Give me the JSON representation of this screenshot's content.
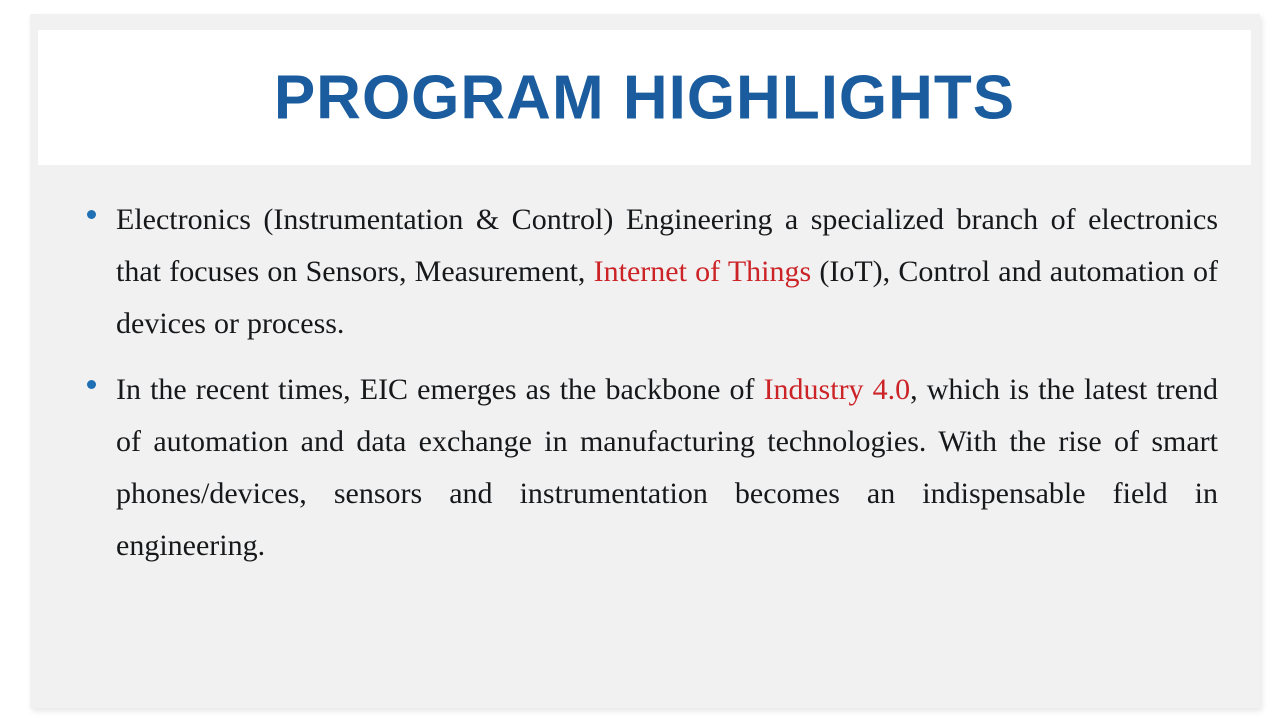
{
  "slide": {
    "title": "PROGRAM HIGHLIGHTS",
    "title_color": "#1a5c9e",
    "canvas_color": "#f1f1f2",
    "title_band_color": "#ffffff",
    "bullet_marker_color": "#1f6fb5",
    "body_text_color": "#16181a",
    "accent_color": "#cc2327"
  },
  "bullets": [
    {
      "marker": "bullet-dot",
      "segments": [
        {
          "text": "Electronics (Instrumentation & Control) Engineering a specialized branch of electronics that focuses on Sensors, Measurement, ",
          "emphasis": "none"
        },
        {
          "text": "Internet of Things",
          "emphasis": "accent"
        },
        {
          "text": " (IoT), Control and automation of devices or process.",
          "emphasis": "none"
        }
      ],
      "plain_text": "Electronics (Instrumentation & Control) Engineering a specialized branch of electronics that focuses on Sensors, Measurement, Internet of Things (IoT), Control and automation of devices or process."
    },
    {
      "marker": "bullet-dot",
      "segments": [
        {
          "text": "In the recent times, EIC emerges as the backbone of ",
          "emphasis": "none"
        },
        {
          "text": "Industry 4.0",
          "emphasis": "accent"
        },
        {
          "text": ", which is the latest trend of automation and data exchange in manufacturing technologies. With the rise of smart phones/devices, sensors and instrumentation becomes an indispensable field in engineering.",
          "emphasis": "none"
        }
      ],
      "plain_text": "In the recent times, EIC emerges as the backbone of Industry 4.0, which is the latest trend of automation and data exchange in manufacturing technologies. With the rise of smart phones/devices, sensors and instrumentation becomes an indispensable field in engineering."
    }
  ]
}
